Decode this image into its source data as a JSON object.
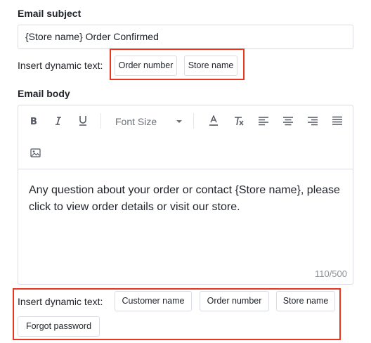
{
  "subject": {
    "label": "Email subject",
    "value": "{Store name} Order Confirmed"
  },
  "subject_dynamic": {
    "label": "Insert dynamic text:",
    "chips": [
      "Order number",
      "Store name"
    ]
  },
  "body": {
    "label": "Email body",
    "font_size_placeholder": "Font Size",
    "content": " Any question about your order or contact {Store name}, please click to view order details or visit our store.",
    "counter": "110/500"
  },
  "body_dynamic": {
    "label": "Insert dynamic text:",
    "chips": [
      "Customer name",
      "Order number",
      "Store name",
      "Forgot password"
    ]
  },
  "colors": {
    "highlight": "#e8361f",
    "border": "#d9dde3",
    "text": "#1f2329",
    "muted": "#8a8f96"
  },
  "toolbar_icons": [
    "bold-icon",
    "italic-icon",
    "underline-icon",
    "font-color-icon",
    "clear-format-icon",
    "align-left-icon",
    "align-center-icon",
    "align-right-icon",
    "align-justify-icon",
    "image-icon"
  ]
}
